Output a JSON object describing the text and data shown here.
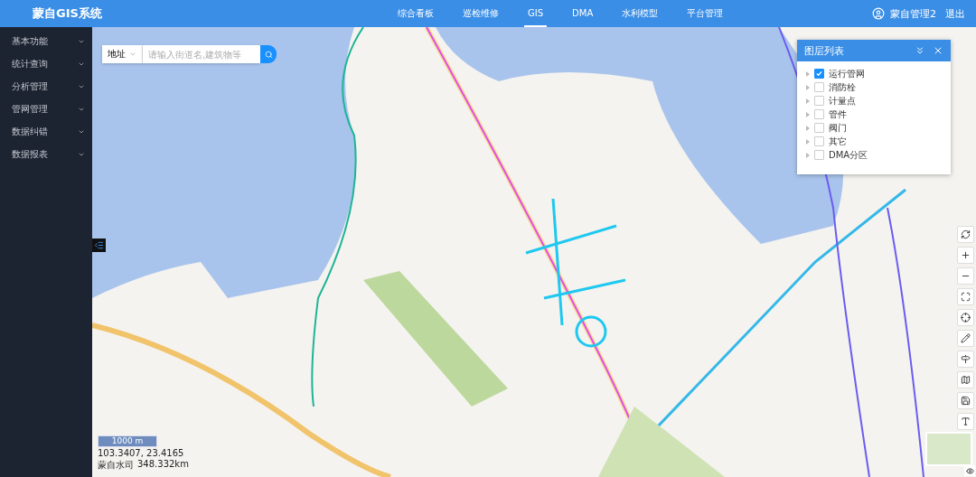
{
  "header": {
    "title": "蒙自GIS系统",
    "nav": [
      {
        "label": "综合看板",
        "selected": false
      },
      {
        "label": "巡检维修",
        "selected": false
      },
      {
        "label": "GIS",
        "selected": true
      },
      {
        "label": "DMA",
        "selected": false
      },
      {
        "label": "水利模型",
        "selected": false
      },
      {
        "label": "平台管理",
        "selected": false
      }
    ],
    "user": "蒙自管理2",
    "logout": "退出"
  },
  "sidebar": {
    "items": [
      {
        "label": "基本功能",
        "expanded": false
      },
      {
        "label": "统计查询",
        "expanded": false
      },
      {
        "label": "分析管理",
        "expanded": false
      },
      {
        "label": "管网管理",
        "expanded": false
      },
      {
        "label": "数据纠错",
        "expanded": false
      },
      {
        "label": "数据报表",
        "expanded": false
      }
    ]
  },
  "search": {
    "type": "地址",
    "placeholder": "请输入街道名,建筑物等"
  },
  "layer_panel": {
    "title": "图层列表",
    "layers": [
      {
        "label": "运行管网",
        "checked": true
      },
      {
        "label": "消防栓",
        "checked": false
      },
      {
        "label": "计量点",
        "checked": false
      },
      {
        "label": "管件",
        "checked": false
      },
      {
        "label": "阀门",
        "checked": false
      },
      {
        "label": "其它",
        "checked": false
      },
      {
        "label": "DMA分区",
        "checked": false
      }
    ]
  },
  "status": {
    "scale": "1000 m",
    "coordinates": "103.3407, 23.4165",
    "company": "蒙自水司",
    "distance": "348.332km"
  }
}
